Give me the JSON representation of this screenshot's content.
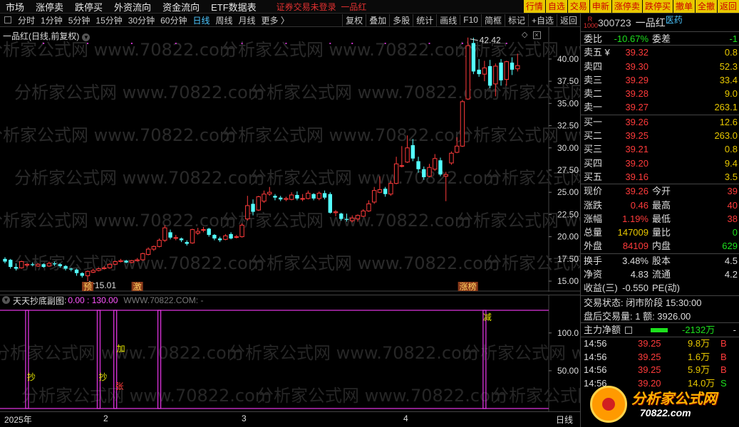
{
  "menubar": {
    "items": [
      "市场",
      "涨停卖",
      "跌停买",
      "外资流向",
      "资金流向",
      "ETF数据表"
    ],
    "login": "证券交易未登录",
    "stock": "一品红",
    "right_buttons": [
      "行情",
      "自选",
      "交易",
      "申新",
      "涨停卖",
      "跌停买",
      "撤单",
      "全撤",
      "返回"
    ]
  },
  "periodbar": {
    "periods": [
      "分时",
      "1分钟",
      "5分钟",
      "15分钟",
      "30分钟",
      "60分钟",
      "日线",
      "周线",
      "月线",
      "更多 〉"
    ],
    "active": "日线",
    "tools": [
      "复权",
      "叠加",
      "多股",
      "统计",
      "画线",
      "F10",
      "简框",
      "标记",
      "+自选",
      "返回"
    ]
  },
  "chart": {
    "title": "一品红(日线,前复权)",
    "watermark": "分析家公式网 www.70822.com",
    "high_label": "42.42",
    "low_label": "15.01",
    "markers": [
      {
        "text": "预",
        "index": 15
      },
      {
        "text": "激",
        "index": 24
      },
      {
        "text": "涨榜",
        "index": 84
      }
    ]
  },
  "indicator": {
    "name": "天天抄底副图",
    "range": "0.00 : 130.00",
    "source": "WWW.70822.COM: -",
    "y_ticks": [
      100.0,
      50.0
    ],
    "y_tick_labels": [
      "100.0",
      "50.00"
    ],
    "signals": [
      {
        "text": "抄",
        "index": 4
      },
      {
        "text": "抄",
        "index": 17
      },
      {
        "text": "张",
        "index": 20
      },
      {
        "text": "加",
        "index": 20
      },
      {
        "text": "减",
        "index": 87
      }
    ]
  },
  "dateaxis": {
    "labels": [
      "2025年",
      "2",
      "3",
      "4"
    ],
    "period": "日线"
  },
  "quote": {
    "badge": "R 1000",
    "code": "300723",
    "name": "一品红",
    "industry": "医药",
    "weibi": {
      "label": "委比",
      "value": "-10.67%",
      "label2": "委差",
      "value2": "-1"
    },
    "sells": [
      {
        "label": "卖五 ¥",
        "price": "39.32",
        "vol": "0.8"
      },
      {
        "label": "卖四",
        "price": "39.30",
        "vol": "52.3"
      },
      {
        "label": "卖三",
        "price": "39.29",
        "vol": "33.4"
      },
      {
        "label": "卖二",
        "price": "39.28",
        "vol": "9.0"
      },
      {
        "label": "卖一",
        "price": "39.27",
        "vol": "263.1"
      }
    ],
    "buys": [
      {
        "label": "买一",
        "price": "39.26",
        "vol": "12.6"
      },
      {
        "label": "买二",
        "price": "39.25",
        "vol": "263.0"
      },
      {
        "label": "买三",
        "price": "39.21",
        "vol": "0.8"
      },
      {
        "label": "买四",
        "price": "39.20",
        "vol": "9.4"
      },
      {
        "label": "买五",
        "price": "39.16",
        "vol": "3.5"
      }
    ],
    "stats": [
      {
        "l": "现价",
        "v": "39.26",
        "vc": "red",
        "l2": "今开",
        "v2": "39",
        "v2c": "red"
      },
      {
        "l": "涨跌",
        "v": "0.46",
        "vc": "red",
        "l2": "最高",
        "v2": "40",
        "v2c": "red"
      },
      {
        "l": "涨幅",
        "v": "1.19%",
        "vc": "red",
        "l2": "最低",
        "v2": "38",
        "v2c": "red"
      },
      {
        "l": "总量",
        "v": "147009",
        "vc": "yellow",
        "l2": "量比",
        "v2": "0",
        "v2c": "green"
      },
      {
        "l": "外盘",
        "v": "84109",
        "vc": "red",
        "l2": "内盘",
        "v2": "629",
        "v2c": "green"
      }
    ],
    "stats2": [
      {
        "l": "换手",
        "v": "3.48%",
        "vc": "white",
        "l2": "股本",
        "v2": "4.5",
        "v2c": "white"
      },
      {
        "l": "净资",
        "v": "4.83",
        "vc": "white",
        "l2": "流通",
        "v2": "4.2",
        "v2c": "white"
      },
      {
        "l": "收益(三)",
        "v": "-0.550",
        "vc": "white",
        "l2": "PE(动)",
        "v2": "",
        "v2c": "white"
      }
    ],
    "status": "交易状态: 闭市阶段 15:30:00",
    "after_hours": "盘后交易量: 1  额: 3926.00",
    "flow_label": "主力净额",
    "flow_value": "-2132万",
    "flow_tail": "-",
    "ticks": [
      {
        "t": "14:56",
        "p": "39.25",
        "vol": "9.8万",
        "bs": "B"
      },
      {
        "t": "14:56",
        "p": "39.25",
        "vol": "1.6万",
        "bs": "B"
      },
      {
        "t": "14:56",
        "p": "39.25",
        "vol": "5.9万",
        "bs": "B"
      },
      {
        "t": "14:56",
        "p": "39.20",
        "vol": "14.0万",
        "bs": "S"
      }
    ]
  },
  "logo": {
    "t1": "分析家公式网",
    "t2": "70822.com"
  },
  "chart_data": {
    "type": "candlestick",
    "title": "一品红(日线,前复权)",
    "y_ticks": [
      15.0,
      17.5,
      20.0,
      22.5,
      25.0,
      27.5,
      30.0,
      32.5,
      35.0,
      37.5,
      40.0
    ],
    "y_tick_labels": [
      "15.00",
      "17.50",
      "20.00",
      "22.50",
      "25.00",
      "27.50",
      "30.00",
      "32.50",
      "35.00",
      "37.50",
      "40.00"
    ],
    "ylim": [
      13.8,
      43.6
    ],
    "ohlc": [
      [
        17.5,
        17.2,
        17.7,
        17.0
      ],
      [
        17.4,
        16.6,
        17.5,
        16.4
      ],
      [
        16.6,
        16.4,
        17.0,
        16.2
      ],
      [
        16.5,
        17.2,
        17.3,
        16.4
      ],
      [
        16.8,
        16.9,
        17.0,
        16.6
      ],
      [
        16.9,
        16.8,
        17.1,
        16.7
      ],
      [
        16.7,
        16.9,
        17.0,
        16.6
      ],
      [
        16.9,
        16.6,
        17.0,
        16.5
      ],
      [
        16.7,
        17.0,
        17.2,
        16.6
      ],
      [
        17.0,
        16.9,
        17.2,
        16.7
      ],
      [
        16.9,
        16.7,
        17.0,
        16.5
      ],
      [
        16.7,
        16.4,
        16.8,
        16.2
      ],
      [
        16.4,
        16.3,
        16.5,
        16.1
      ],
      [
        16.3,
        15.9,
        16.4,
        15.6
      ],
      [
        15.9,
        15.6,
        16.0,
        15.4
      ],
      [
        15.6,
        16.1,
        16.2,
        15.0
      ],
      [
        16.0,
        16.2,
        16.4,
        15.9
      ],
      [
        16.2,
        16.4,
        16.5,
        16.1
      ],
      [
        16.4,
        16.5,
        16.7,
        16.3
      ],
      [
        16.5,
        16.9,
        17.0,
        16.4
      ],
      [
        16.9,
        17.2,
        17.3,
        16.8
      ],
      [
        17.2,
        17.3,
        17.5,
        17.1
      ],
      [
        17.3,
        17.1,
        17.4,
        17.0
      ],
      [
        17.1,
        17.3,
        17.4,
        17.0
      ],
      [
        17.3,
        17.4,
        17.6,
        17.2
      ],
      [
        17.4,
        18.1,
        18.2,
        17.3
      ],
      [
        18.0,
        18.6,
        18.8,
        17.9
      ],
      [
        18.6,
        18.9,
        19.0,
        18.4
      ],
      [
        18.9,
        19.6,
        19.8,
        18.8
      ],
      [
        19.6,
        21.0,
        21.3,
        19.4
      ],
      [
        20.5,
        19.9,
        20.8,
        19.7
      ],
      [
        19.9,
        19.9,
        20.2,
        19.6
      ],
      [
        19.8,
        19.6,
        19.9,
        19.4
      ],
      [
        19.4,
        19.2,
        19.6,
        19.0
      ],
      [
        19.3,
        20.8,
        20.9,
        19.2
      ],
      [
        20.4,
        20.6,
        21.0,
        20.2
      ],
      [
        20.8,
        20.8,
        21.1,
        20.5
      ],
      [
        20.9,
        20.2,
        21.0,
        20.0
      ],
      [
        20.2,
        19.8,
        20.3,
        19.6
      ],
      [
        19.8,
        19.6,
        20.0,
        19.4
      ],
      [
        19.7,
        20.1,
        20.3,
        19.6
      ],
      [
        20.3,
        19.8,
        20.5,
        19.7
      ],
      [
        20.0,
        20.0,
        20.2,
        19.8
      ],
      [
        20.0,
        21.3,
        21.5,
        19.9
      ],
      [
        22.0,
        23.5,
        24.6,
        21.8
      ],
      [
        23.7,
        22.8,
        24.2,
        22.4
      ],
      [
        23.0,
        24.5,
        24.6,
        22.9
      ],
      [
        24.0,
        24.8,
        25.2,
        23.8
      ],
      [
        24.8,
        25.0,
        25.6,
        24.6
      ],
      [
        24.6,
        24.4,
        24.8,
        24.1
      ],
      [
        24.4,
        24.2,
        24.6,
        24.0
      ],
      [
        24.2,
        24.3,
        24.5,
        24.0
      ],
      [
        24.2,
        24.7,
        25.0,
        24.1
      ],
      [
        24.7,
        24.3,
        25.1,
        24.1
      ],
      [
        24.3,
        24.3,
        24.8,
        24.0
      ],
      [
        24.3,
        24.9,
        25.2,
        24.2
      ],
      [
        24.8,
        24.3,
        24.9,
        24.1
      ],
      [
        24.3,
        24.9,
        25.1,
        24.1
      ],
      [
        24.9,
        24.4,
        25.2,
        24.2
      ],
      [
        24.8,
        22.7,
        25.0,
        22.6
      ],
      [
        22.7,
        22.8,
        23.0,
        22.3
      ],
      [
        22.6,
        22.0,
        22.7,
        21.8
      ],
      [
        22.0,
        21.9,
        22.6,
        21.7
      ],
      [
        21.8,
        22.1,
        22.4,
        21.6
      ],
      [
        22.0,
        22.4,
        22.5,
        21.7
      ],
      [
        22.3,
        22.9,
        23.1,
        22.2
      ],
      [
        22.9,
        23.7,
        24.1,
        22.8
      ],
      [
        23.9,
        25.2,
        25.6,
        23.7
      ],
      [
        25.0,
        25.3,
        26.8,
        24.9
      ],
      [
        25.4,
        24.8,
        25.6,
        24.5
      ],
      [
        24.8,
        26.0,
        26.3,
        24.6
      ],
      [
        26.0,
        28.2,
        29.0,
        25.9
      ],
      [
        28.0,
        28.0,
        30.2,
        27.8
      ],
      [
        28.4,
        30.0,
        31.4,
        28.3
      ],
      [
        30.3,
        28.8,
        31.0,
        28.5
      ],
      [
        28.5,
        27.6,
        29.0,
        27.2
      ],
      [
        27.6,
        26.7,
        27.9,
        26.4
      ],
      [
        26.8,
        27.8,
        28.2,
        26.7
      ],
      [
        27.6,
        28.8,
        29.3,
        27.4
      ],
      [
        28.6,
        27.0,
        28.9,
        26.8
      ],
      [
        26.8,
        27.0,
        27.3,
        24.0
      ],
      [
        28.3,
        29.4,
        29.6,
        28.1
      ],
      [
        29.5,
        30.2,
        31.2,
        29.4
      ],
      [
        30.2,
        35.2,
        35.4,
        30.1
      ],
      [
        35.5,
        41.5,
        42.42,
        35.4
      ],
      [
        41.8,
        38.6,
        42.4,
        38.3
      ],
      [
        38.8,
        38.3,
        40.0,
        38.0
      ],
      [
        38.3,
        39.0,
        39.8,
        37.5
      ],
      [
        39.2,
        37.0,
        39.9,
        36.7
      ],
      [
        37.2,
        39.2,
        39.5,
        35.8
      ],
      [
        39.6,
        37.6,
        40.0,
        37.0
      ],
      [
        37.7,
        39.7,
        39.8,
        37.0
      ],
      [
        39.6,
        38.8,
        40.2,
        38.2
      ],
      [
        38.9,
        39.26,
        40.6,
        38.6
      ]
    ],
    "indicator": {
      "name": "天天抄底副图",
      "range": [
        0,
        130
      ],
      "y_ticks": [
        100,
        50
      ],
      "signal_bars": [
        4,
        17,
        20,
        28,
        87
      ],
      "signal_bar_heights": [
        130,
        130,
        130,
        130,
        130
      ]
    }
  }
}
